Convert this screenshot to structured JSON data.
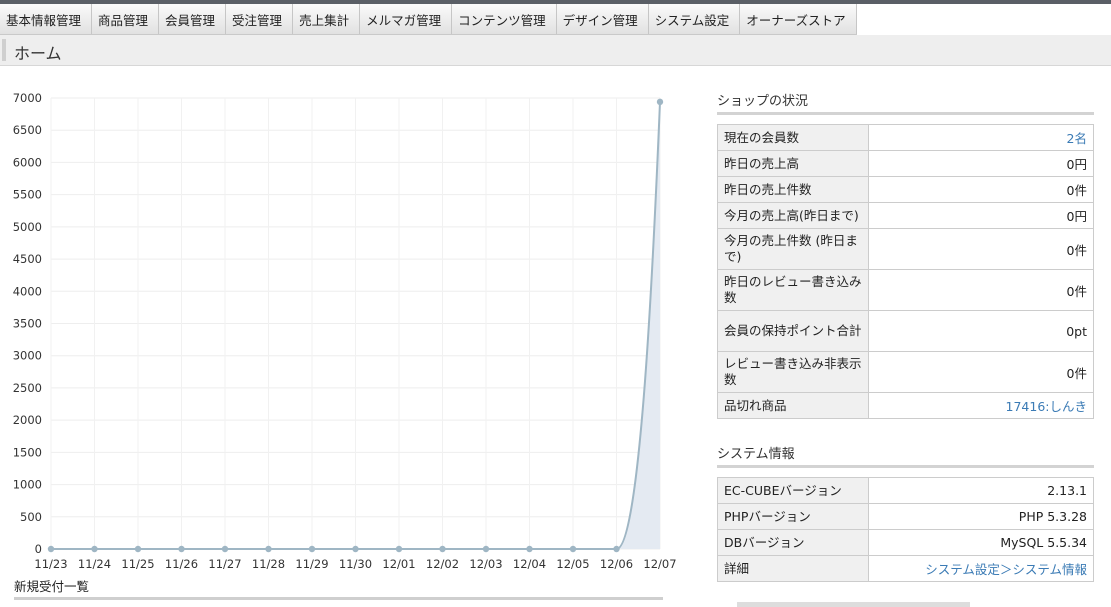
{
  "nav": {
    "items": [
      {
        "label": "基本情報管理",
        "name": "nav-basic-info"
      },
      {
        "label": "商品管理",
        "name": "nav-products"
      },
      {
        "label": "会員管理",
        "name": "nav-members"
      },
      {
        "label": "受注管理",
        "name": "nav-orders"
      },
      {
        "label": "売上集計",
        "name": "nav-sales"
      },
      {
        "label": "メルマガ管理",
        "name": "nav-mailmagazine"
      },
      {
        "label": "コンテンツ管理",
        "name": "nav-contents"
      },
      {
        "label": "デザイン管理",
        "name": "nav-design"
      },
      {
        "label": "システム設定",
        "name": "nav-system"
      },
      {
        "label": "オーナーズストア",
        "name": "nav-owners-store"
      }
    ]
  },
  "page": {
    "title": "ホーム"
  },
  "chart_data": {
    "type": "line",
    "categories": [
      "11/23",
      "11/24",
      "11/25",
      "11/26",
      "11/27",
      "11/28",
      "11/29",
      "11/30",
      "12/01",
      "12/02",
      "12/03",
      "12/04",
      "12/05",
      "12/06",
      "12/07"
    ],
    "values": [
      0,
      0,
      0,
      0,
      0,
      0,
      0,
      0,
      0,
      0,
      0,
      0,
      0,
      0,
      6940
    ],
    "y_ticks": [
      0,
      500,
      1000,
      1500,
      2000,
      2500,
      3000,
      3500,
      4000,
      4500,
      5000,
      5500,
      6000,
      6500,
      7000
    ],
    "ylim": [
      0,
      7000
    ],
    "grid": true,
    "area_fill": true,
    "line_color": "#9fb6c4",
    "fill_color": "#e4eaf2"
  },
  "orders": {
    "heading": "新規受付一覧"
  },
  "shop_status": {
    "heading": "ショップの状況",
    "rows": [
      {
        "label": "現在の会員数",
        "value": "2名",
        "link": true
      },
      {
        "label": "昨日の売上高",
        "value": "0円",
        "link": false
      },
      {
        "label": "昨日の売上件数",
        "value": "0件",
        "link": false
      },
      {
        "label": "今月の売上高(昨日まで)",
        "value": "0円",
        "link": false
      },
      {
        "label": "今月の売上件数 (昨日まで)",
        "value": "0件",
        "link": false
      },
      {
        "label": "昨日のレビュー書き込み数",
        "value": "0件",
        "link": false
      },
      {
        "label": "会員の保持ポイント合計",
        "value": "0pt",
        "link": false
      },
      {
        "label": "レビュー書き込み非表示数",
        "value": "0件",
        "link": false
      },
      {
        "label": "品切れ商品",
        "value": "17416:しんき",
        "link": true
      }
    ]
  },
  "system_info": {
    "heading": "システム情報",
    "rows": [
      {
        "label": "EC-CUBEバージョン",
        "value": "2.13.1",
        "link": false
      },
      {
        "label": "PHPバージョン",
        "value": "PHP 5.3.28",
        "link": false
      },
      {
        "label": "DBバージョン",
        "value": "MySQL 5.5.34",
        "link": false
      },
      {
        "label": "詳細",
        "value": "システム設定＞システム情報",
        "link": true
      }
    ]
  },
  "colors": {
    "link": "#3b7bb5",
    "accent": "#9fb6c4"
  }
}
